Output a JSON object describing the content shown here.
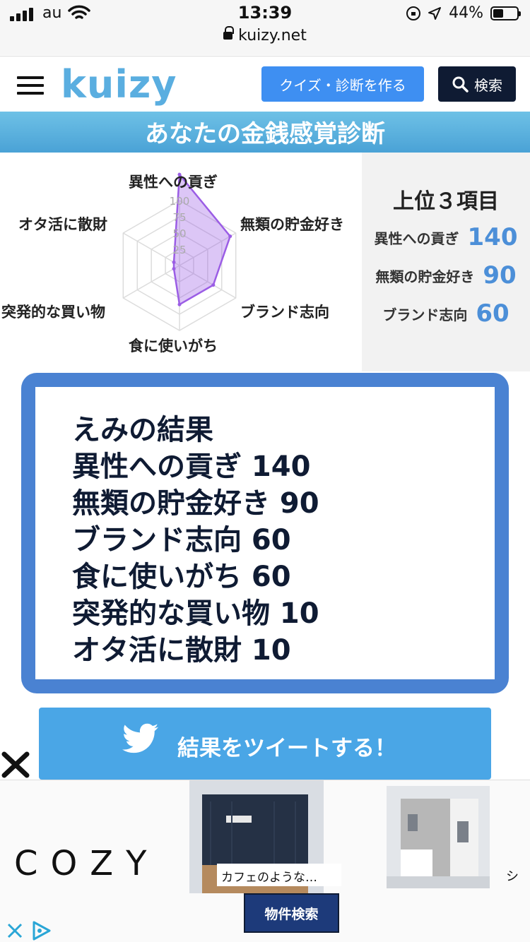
{
  "status_bar": {
    "carrier": "au",
    "time": "13:39",
    "battery": "44%",
    "url": "kuizy.net"
  },
  "header": {
    "logo": "kuizy",
    "make_quiz_button": "クイズ・診断を作る",
    "search_button": "検索"
  },
  "banner": {
    "title": "あなたの金銭感覚診断"
  },
  "chart_data": {
    "type": "radar",
    "axes": [
      "異性への貢ぎ",
      "無類の貯金好き",
      "ブランド志向",
      "食に使いがち",
      "突発的な買い物",
      "オタ活に散財"
    ],
    "values": [
      140,
      90,
      60,
      60,
      10,
      10
    ],
    "tick_labels": [
      "25",
      "50",
      "75",
      "100"
    ],
    "range": [
      0,
      100
    ],
    "series_color": "#9b5de5"
  },
  "top3": {
    "title": "上位３項目",
    "items": [
      {
        "name": "異性への貢ぎ",
        "value": "140"
      },
      {
        "name": "無類の貯金好き",
        "value": "90"
      },
      {
        "name": "ブランド志向",
        "value": "60"
      }
    ]
  },
  "result": {
    "lines": [
      "えみの結果",
      "異性への貢ぎ 140",
      "無類の貯金好き 90",
      "ブランド志向 60",
      "食に使いがち 60",
      "突発的な買い物 10",
      "オタ活に散財 10"
    ]
  },
  "tweet": {
    "label": "結果をツイートする！"
  },
  "ad": {
    "brand": "COZY",
    "caption": "カフェのような…",
    "right_text": "シ",
    "cta": "物件検索"
  }
}
